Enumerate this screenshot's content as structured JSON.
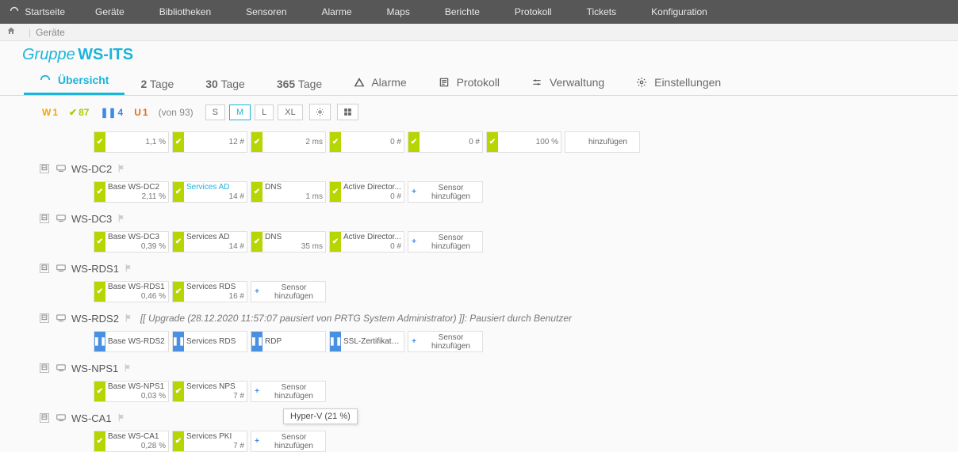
{
  "topnav": [
    "Startseite",
    "Geräte",
    "Bibliotheken",
    "Sensoren",
    "Alarme",
    "Maps",
    "Berichte",
    "Protokoll",
    "Tickets",
    "Konfiguration"
  ],
  "breadcrumb": {
    "item": "Geräte"
  },
  "title": {
    "prefix": "Gruppe",
    "name": "WS-ITS"
  },
  "tabs": {
    "overview": "Übersicht",
    "d2_n": "2",
    "d2_t": "Tage",
    "d30_n": "30",
    "d30_t": "Tage",
    "d365_n": "365",
    "d365_t": "Tage",
    "alarms": "Alarme",
    "log": "Protokoll",
    "admin": "Verwaltung",
    "settings": "Einstellungen"
  },
  "counters": {
    "W": "1",
    "ok": "87",
    "pause": "4",
    "U": "1",
    "total": "(von 93)"
  },
  "sizes": {
    "S": "S",
    "M": "M",
    "L": "L",
    "XL": "XL"
  },
  "summary_row": [
    "1,1 %",
    "12 #",
    "2 ms",
    "0 #",
    "0 #",
    "100 %"
  ],
  "add_label": "hinzufügen",
  "add_sensor_label": "Sensor hinzufügen",
  "devices": [
    {
      "name": "WS-DC2",
      "sensors": [
        {
          "status": "ok",
          "name": "Base WS-DC2",
          "val": "2,11 %"
        },
        {
          "status": "ok",
          "name": "Services AD",
          "val": "14 #",
          "link": true
        },
        {
          "status": "ok",
          "name": "DNS",
          "val": "1 ms"
        },
        {
          "status": "ok",
          "name": "Active Director...",
          "val": "0 #"
        }
      ],
      "add": true
    },
    {
      "name": "WS-DC3",
      "sensors": [
        {
          "status": "ok",
          "name": "Base WS-DC3",
          "val": "0,39 %"
        },
        {
          "status": "ok",
          "name": "Services AD",
          "val": "14 #"
        },
        {
          "status": "ok",
          "name": "DNS",
          "val": "35 ms"
        },
        {
          "status": "ok",
          "name": "Active Director...",
          "val": "0 #"
        }
      ],
      "add": true
    },
    {
      "name": "WS-RDS1",
      "sensors": [
        {
          "status": "ok",
          "name": "Base WS-RDS1",
          "val": "0,46 %"
        },
        {
          "status": "ok",
          "name": "Services RDS",
          "val": "16 #"
        }
      ],
      "add": true
    },
    {
      "name": "WS-RDS2",
      "note": "[[ Upgrade (28.12.2020 11:57:07 pausiert von PRTG System Administrator) ]]: Pausiert durch Benutzer",
      "sensors": [
        {
          "status": "pause",
          "name": "Base WS-RDS2",
          "val": ""
        },
        {
          "status": "pause",
          "name": "Services RDS",
          "val": ""
        },
        {
          "status": "pause",
          "name": "RDP",
          "val": ""
        },
        {
          "status": "pause",
          "name": "SSL-Zertifikats...",
          "val": ""
        }
      ],
      "add": true
    },
    {
      "name": "WS-NPS1",
      "sensors": [
        {
          "status": "ok",
          "name": "Base WS-NPS1",
          "val": "0,03 %"
        },
        {
          "status": "ok",
          "name": "Services NPS",
          "val": "7 #"
        }
      ],
      "add": true
    },
    {
      "name": "WS-CA1",
      "sensors": [
        {
          "status": "ok",
          "name": "Base WS-CA1",
          "val": "0,28 %"
        },
        {
          "status": "ok",
          "name": "Services PKI",
          "val": "7 #"
        }
      ],
      "add": true
    }
  ],
  "tooltip": "Hyper-V (21 %)"
}
